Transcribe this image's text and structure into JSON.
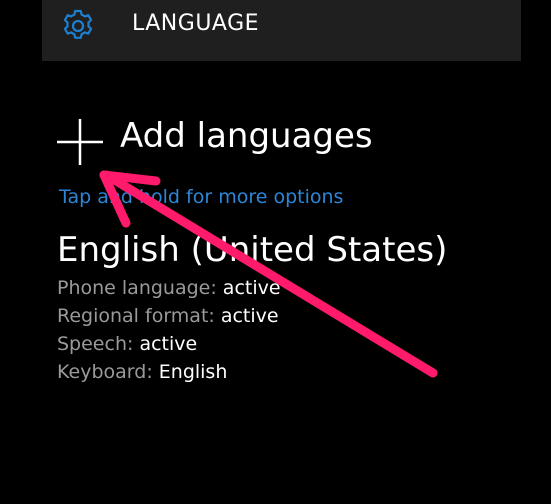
{
  "header": {
    "title": "LANGUAGE",
    "icon": "gear-icon",
    "icon_color": "#1e7fd0"
  },
  "add_languages": {
    "icon": "plus-icon",
    "label": "Add languages"
  },
  "hint": "Tap and hold for more options",
  "languages": [
    {
      "name": "English (United States)",
      "details": [
        {
          "key": "Phone language:",
          "value": "active"
        },
        {
          "key": "Regional format:",
          "value": "active"
        },
        {
          "key": "Speech:",
          "value": "active"
        },
        {
          "key": "Keyboard:",
          "value": "English"
        }
      ]
    }
  ],
  "annotation": {
    "type": "arrow",
    "color": "#ff1a6b"
  },
  "colors": {
    "background": "#000000",
    "header_background": "#1f1f1f",
    "accent": "#2b86d7",
    "secondary_text": "#9a9a9a"
  }
}
